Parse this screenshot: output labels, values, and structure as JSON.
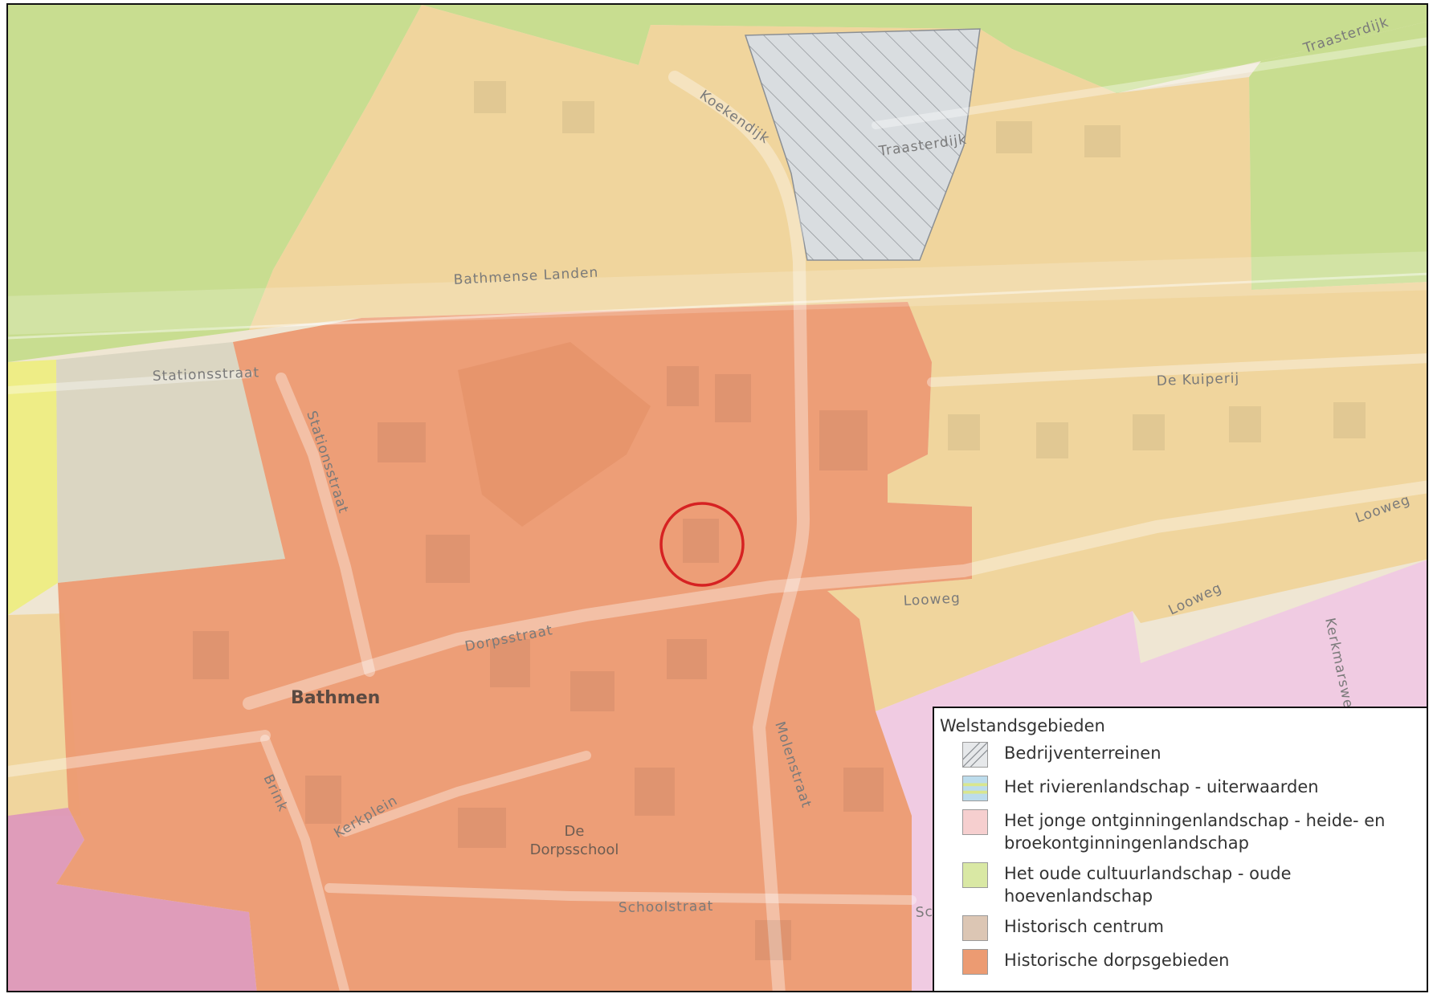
{
  "map": {
    "place_label": "Bathmen",
    "poi_label_line1": "De",
    "poi_label_line2": "Dorpsschool",
    "streets": {
      "traasterdijk_1": "Traasterdijk",
      "traasterdijk_2": "Traasterdijk",
      "koekendijk": "Koekendijk",
      "bathmense_landen": "Bathmense Landen",
      "stationsstraat_1": "Stationsstraat",
      "stationsstraat_2": "Stationsstraat",
      "de_kuiperij": "De Kuiperij",
      "looweg_1": "Looweg",
      "looweg_2": "Looweg",
      "looweg_3": "Looweg",
      "dorpsstraat": "Dorpsstraat",
      "kerkmarsweg": "Kerkmarswe",
      "molenstraat": "Molenstraat",
      "brink": "Brink",
      "kerkplein": "Kerkplein",
      "schoolstraat": "Schoolstraat",
      "schoolstraat_cut": "Sc"
    },
    "zone_colors": {
      "bedrijventerreinen": "#d9dde0",
      "rivierenlandschap": "#bcdcec",
      "jonge_ontginning": "#f2c6c6",
      "oude_cultuur": "#cfe39a",
      "historisch_centrum": "#dcc6b4",
      "historische_dorpsgebieden": "#ec9b72",
      "oude_cultuur_map": "#c5dc8c",
      "essen_zone": "#efd49a",
      "pink_zone": "#efc9e3",
      "mauve_zone": "#dd98b8",
      "yellow_zone": "#eded82"
    },
    "marker_color": "#d62222"
  },
  "legend": {
    "title": "Welstandsgebieden",
    "items": [
      {
        "label_1": "Bedrijventerreinen",
        "label_2": ""
      },
      {
        "label_1": "Het rivierenlandschap - uiterwaarden",
        "label_2": ""
      },
      {
        "label_1": "Het jonge ontginningenlandschap - heide- en",
        "label_2": "broekontginningenlandschap"
      },
      {
        "label_1": "Het oude cultuurlandschap - oude",
        "label_2": "hoevenlandschap"
      },
      {
        "label_1": "Historisch centrum",
        "label_2": ""
      },
      {
        "label_1": "Historische dorpsgebieden",
        "label_2": ""
      }
    ]
  }
}
